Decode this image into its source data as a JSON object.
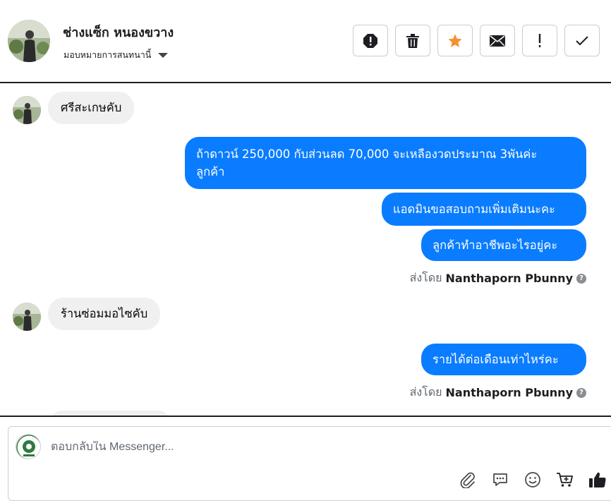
{
  "header": {
    "contact_name": "ช่างแซ็ก หนองขวาง",
    "assign_label": "มอบหมายการสนทนานี้",
    "actions": [
      {
        "icon": "alert-octagon-icon"
      },
      {
        "icon": "trash-icon"
      },
      {
        "icon": "star-icon"
      },
      {
        "icon": "envelope-icon"
      },
      {
        "icon": "exclamation-icon"
      },
      {
        "icon": "checkmark-icon"
      }
    ]
  },
  "conversation": {
    "messages": [
      {
        "direction": "incoming",
        "text": "ศรีสะเกษคับ"
      },
      {
        "direction": "outgoing",
        "lines": [
          "ถ้าดาวน์ 250,000 กับส่วนลด 70,000 จะเหลืองวดประมาณ 3พันค่ะ",
          "ลูกค้า"
        ]
      },
      {
        "direction": "outgoing",
        "text": "แอดมินขอสอบถามเพิ่มเติมนะคะ"
      },
      {
        "direction": "outgoing",
        "text": "ลูกค้าทำอาชีพอะไรอยู่คะ"
      },
      {
        "direction": "incoming",
        "text": "ร้านซ่อมมอไซคับ"
      },
      {
        "direction": "outgoing",
        "text": "รายได้ต่อเดือนเท่าไหร่คะ"
      }
    ],
    "sent_by_prefix": "ส่งโดย",
    "sent_by_name": "Nanthaporn Pbunny",
    "help_glyph": "?"
  },
  "composer": {
    "placeholder": "ตอบกลับใน Messenger...",
    "tools": [
      "paperclip-icon",
      "chat-bubble-icon",
      "smiley-icon",
      "cart-plus-icon",
      "thumbs-up-icon"
    ]
  },
  "colors": {
    "outgoing_bubble": "#0a7cff",
    "incoming_bubble": "#f0f0f0",
    "star": "#f5922f",
    "divider": "#1c1e21"
  }
}
